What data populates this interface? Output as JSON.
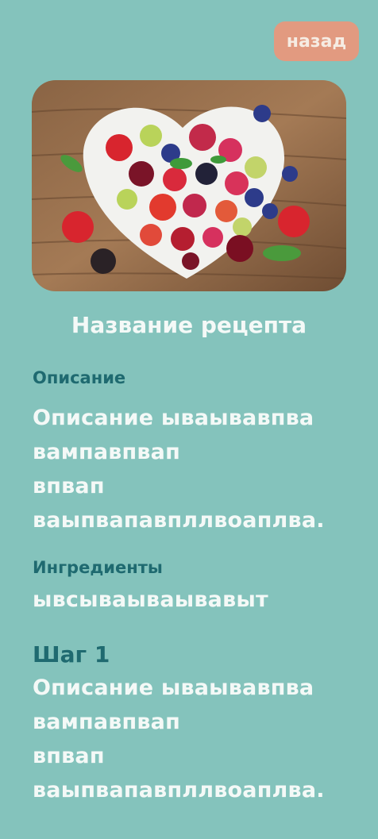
{
  "header": {
    "back_label": "назад"
  },
  "recipe": {
    "title": "Название рецепта",
    "description_label": "Описание",
    "description_text": "Описание ываывавпва\nвампавпвап\nвпвап\nваыпвапавпллвоаплва.",
    "ingredients_label": "Ингредиенты",
    "ingredients_text": "ывсываываывавыт",
    "steps": [
      {
        "label": "Шаг 1",
        "text": "Описание ываывавпва\nвампавпвап\nвпвап\nваыпвапавпллвоаплва."
      }
    ]
  },
  "colors": {
    "background": "#84c3bc",
    "accent_button": "#e29a80",
    "label": "#1f6a70",
    "text": "#f4f9f7"
  },
  "image": {
    "icon": "fruit-bowl-photo"
  }
}
